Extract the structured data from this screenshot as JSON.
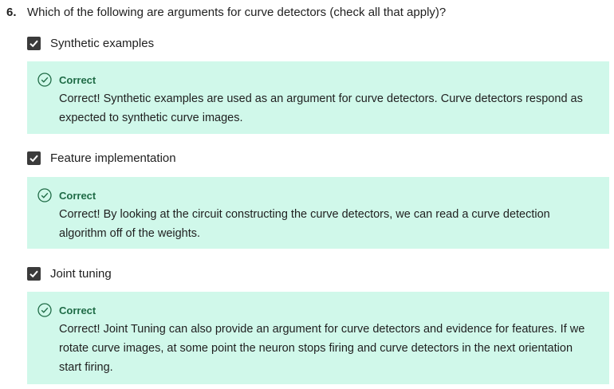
{
  "question": {
    "number": "6.",
    "text": "Which of the following are arguments for curve detectors (check all that apply)?"
  },
  "options": [
    {
      "label": "Synthetic examples",
      "checked": true,
      "feedback_title": "Correct",
      "feedback_text": "Correct! Synthetic examples are used as an argument for curve detectors. Curve detectors respond as expected to synthetic curve images."
    },
    {
      "label": "Feature implementation",
      "checked": true,
      "feedback_title": "Correct",
      "feedback_text": "Correct! By looking at the circuit constructing the curve detectors, we can read a curve detection algorithm off of the weights."
    },
    {
      "label": "Joint tuning",
      "checked": true,
      "feedback_title": "Correct",
      "feedback_text": "Correct! Joint Tuning can also provide an argument for curve detectors and evidence for features. If we rotate curve images, at some point the neuron stops firing and curve detectors in the next orientation start firing."
    }
  ],
  "colors": {
    "feedback_bg": "#d0f8ea",
    "correct_green": "#1f6b46",
    "checkbox": "#3b3b3b"
  }
}
